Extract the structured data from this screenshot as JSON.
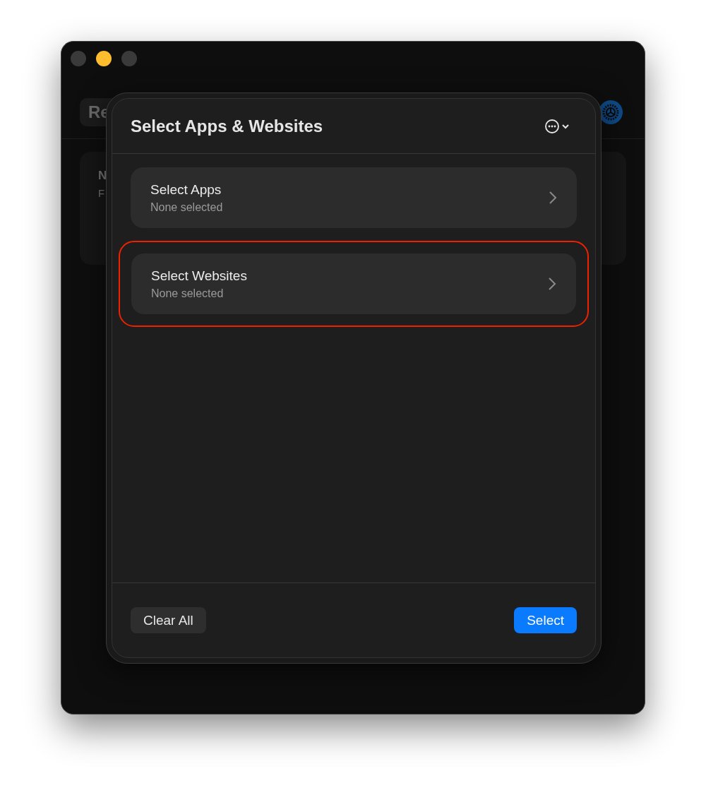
{
  "background_window": {
    "traffic_lights": [
      {
        "color": "#3a3a3a"
      },
      {
        "color": "#febc2e"
      },
      {
        "color": "#3a3a3a"
      }
    ],
    "toolbar_label": "Re",
    "card_title": "N",
    "card_subtitle": "F"
  },
  "sheet": {
    "title": "Select Apps & Websites",
    "rows": [
      {
        "title": "Select Apps",
        "subtitle": "None selected",
        "highlighted": false
      },
      {
        "title": "Select Websites",
        "subtitle": "None selected",
        "highlighted": true
      }
    ],
    "buttons": [
      {
        "label": "Clear All",
        "kind": "secondary"
      },
      {
        "label": "Select",
        "kind": "primary"
      }
    ]
  }
}
